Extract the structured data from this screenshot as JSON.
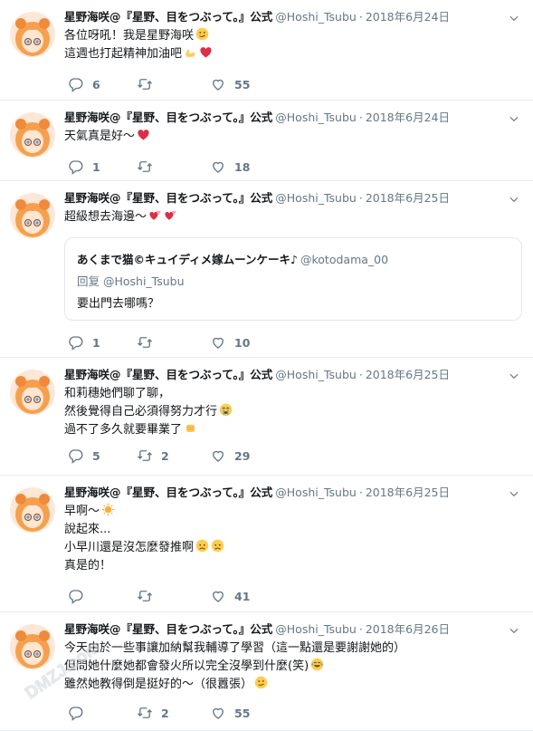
{
  "tweets": [
    {
      "name": "星野海咲@『星野、目をつぶって。』公式",
      "handle": "@Hoshi_Tsubu",
      "date": "2018年6月24日",
      "lines": [
        "各位呀吼！我是星野海咲",
        "這週也打起精神加油吧"
      ],
      "line_emoji": [
        [
          "smirk-emoji"
        ],
        [
          "flex-emoji",
          "heart-emoji"
        ]
      ],
      "replies": "6",
      "retweets": "",
      "likes": "55"
    },
    {
      "name": "星野海咲@『星野、目をつぶって。』公式",
      "handle": "@Hoshi_Tsubu",
      "date": "2018年6月24日",
      "lines": [
        "天氣真是好～"
      ],
      "line_emoji": [
        [
          "heart-emoji"
        ]
      ],
      "replies": "1",
      "retweets": "",
      "likes": "18"
    },
    {
      "name": "星野海咲@『星野、目をつぶって。』公式",
      "handle": "@Hoshi_Tsubu",
      "date": "2018年6月25日",
      "lines": [
        "超級想去海邊～"
      ],
      "line_emoji": [
        [
          "two-hearts-emoji",
          "two-hearts-emoji"
        ]
      ],
      "quote": {
        "name": "あくまで猫©キュイディメ嫁ムーンケーキ♪",
        "handle": "@kotodama_00",
        "reply": "回复 @Hoshi_Tsubu",
        "text": "要出門去哪嗎？"
      },
      "replies": "1",
      "retweets": "",
      "likes": "10"
    },
    {
      "name": "星野海咲@『星野、目をつぶって。』公式",
      "handle": "@Hoshi_Tsubu",
      "date": "2018年6月25日",
      "lines": [
        "和莉穗她們聊了聊，",
        "然後覺得自己必須得努力才行",
        "過不了多久就要畢業了"
      ],
      "line_emoji": [
        [],
        [
          "crying-emoji"
        ],
        [
          "fist-emoji"
        ]
      ],
      "replies": "5",
      "retweets": "2",
      "likes": "29"
    },
    {
      "name": "星野海咲@『星野、目をつぶって。』公式",
      "handle": "@Hoshi_Tsubu",
      "date": "2018年6月25日",
      "lines": [
        "早啊～",
        "說起來...",
        "小早川還是沒怎麼發推啊",
        "真是的！"
      ],
      "line_emoji": [
        [
          "sun-emoji"
        ],
        [],
        [
          "worried-emoji",
          "worried-emoji"
        ],
        []
      ],
      "replies": "",
      "retweets": "",
      "likes": "41"
    },
    {
      "name": "星野海咲@『星野、目をつぶって。』公式",
      "handle": "@Hoshi_Tsubu",
      "date": "2018年6月26日",
      "lines": [
        "今天由於一些事讓加納幫我輔導了學習（這一點還是要謝謝她的）",
        "但問她什麼她都會發火所以完全沒學到什麼(笑)",
        "雖然她教得倒是挺好的～（很囂張）"
      ],
      "line_emoji": [
        [],
        [
          "joy-emoji"
        ],
        [
          "smirk-emoji"
        ]
      ],
      "replies": "",
      "retweets": "2",
      "likes": "55"
    }
  ],
  "watermark": "DMZJ.com",
  "colors": {
    "text": "#14171a",
    "muted": "#657786",
    "divider": "#e6ecf0",
    "heart": "#e0245e"
  },
  "icons": [
    "reply-icon",
    "retweet-icon",
    "like-icon",
    "chevron-down-icon"
  ]
}
